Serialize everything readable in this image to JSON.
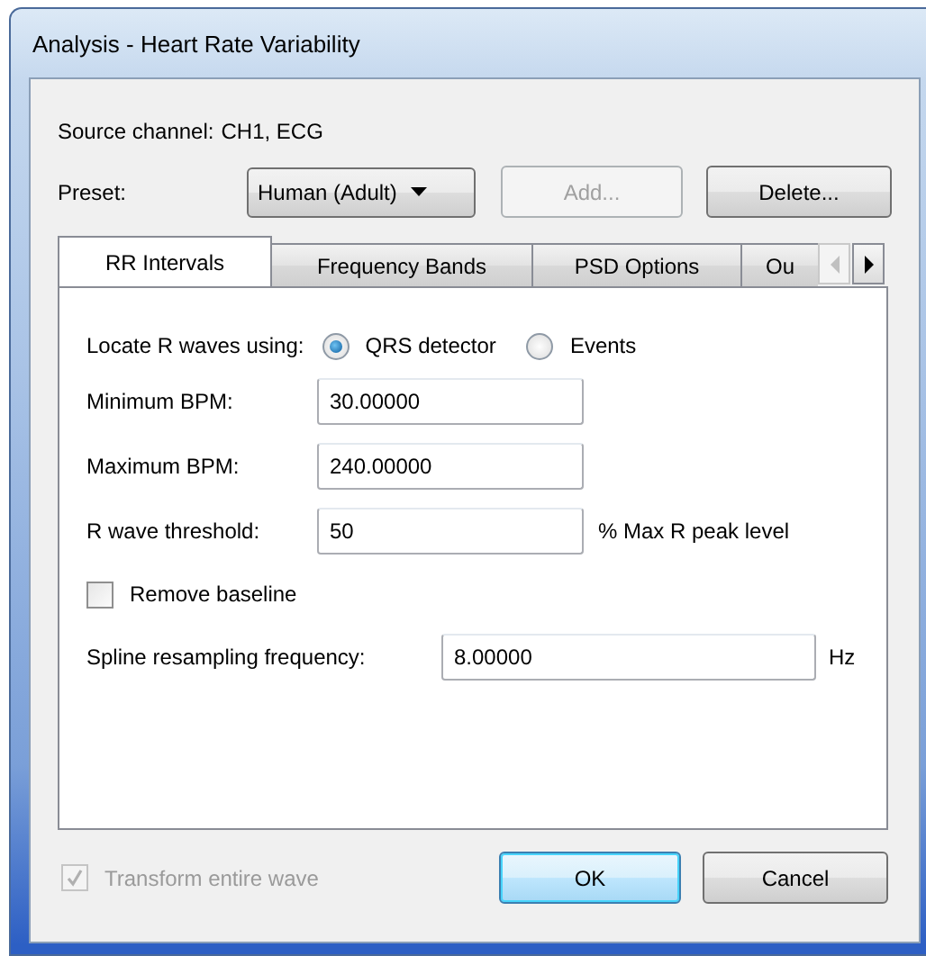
{
  "window": {
    "title": "Analysis - Heart Rate Variability"
  },
  "source_channel": {
    "label": "Source channel:",
    "value": "CH1, ECG"
  },
  "preset": {
    "label": "Preset:",
    "dropdown": {
      "value": "Human (Adult)"
    },
    "buttons": [
      {
        "label": "Add...",
        "disabled": true
      },
      {
        "label": "Delete...",
        "disabled": false
      }
    ]
  },
  "tabs": [
    {
      "label": "RR Intervals",
      "selected": true
    },
    {
      "label": "Frequency Bands",
      "selected": false
    },
    {
      "label": "PSD Options",
      "selected": false
    },
    {
      "label": "Ou",
      "selected": false
    }
  ],
  "tab_scroll": {
    "left_disabled": true,
    "right_disabled": false
  },
  "locate": {
    "label": "Locate R waves using:",
    "options": [
      {
        "label": "QRS detector",
        "selected": true
      },
      {
        "label": "Events",
        "selected": false
      }
    ]
  },
  "fields": [
    {
      "label": "Minimum BPM:",
      "value": "30.00000"
    },
    {
      "label": "Maximum BPM:",
      "value": "240.00000"
    },
    {
      "label": "R wave threshold:",
      "value": "50",
      "unit": "% Max R peak level"
    }
  ],
  "remove_baseline": {
    "label": "Remove baseline",
    "checked": false
  },
  "spline": {
    "label": "Spline resampling frequency:",
    "value": "8.00000",
    "unit": "Hz"
  },
  "transform": {
    "label": "Transform entire wave",
    "checked": true,
    "disabled": true
  },
  "footer_buttons": [
    {
      "label": "OK",
      "default": true
    },
    {
      "label": "Cancel",
      "default": false
    }
  ]
}
